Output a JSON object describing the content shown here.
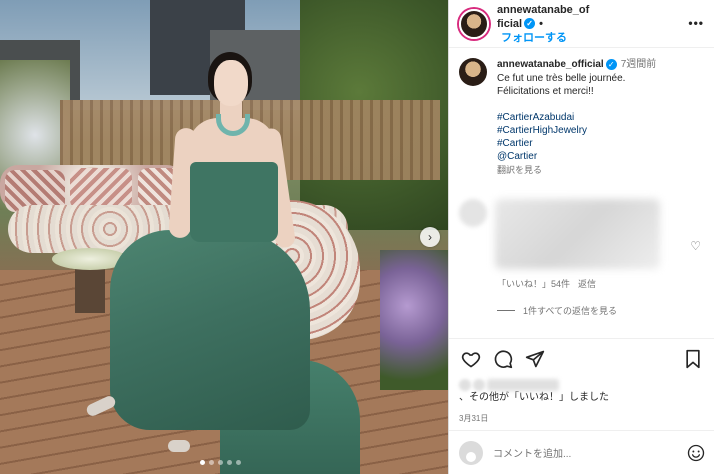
{
  "post": {
    "username": "annewatanabe_official",
    "follow_label": "フォローする",
    "more_label": "•••",
    "carousel_dots": 5,
    "active_dot": 0
  },
  "caption": {
    "username": "annewatanabe_official",
    "time": "7週間前",
    "lines": [
      "Ce fut une très belle journée.",
      "Félicitations et merci!!"
    ],
    "hashtags": [
      "#CartierAzabudai",
      "#CartierHighJewelry",
      "#Cartier",
      "@Cartier"
    ],
    "translate_label": "翻訳を見る"
  },
  "comment": {
    "likes_label": "「いいね！」54件",
    "reply_label": "返信",
    "view_replies_label": "1件すべての返信を見る"
  },
  "likes": {
    "suffix": "、その他が「いいね！」しました",
    "others": "その他"
  },
  "date": "3月31日",
  "add_comment_placeholder": "コメントを追加...",
  "colors": {
    "accent": "#0095f6",
    "hashtag": "#00376b",
    "muted": "#737373"
  }
}
